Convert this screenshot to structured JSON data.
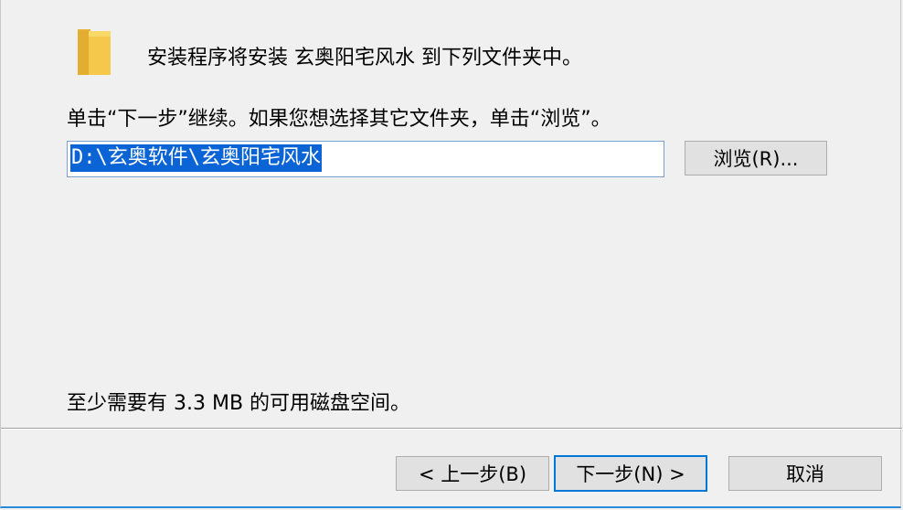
{
  "header": {
    "intro_text": "安装程序将安装 玄奥阳宅风水 到下列文件夹中。"
  },
  "body": {
    "instruction_text": "单击“下一步”继续。如果您想选择其它文件夹，单击“浏览”。",
    "install_path": "D:\\玄奥软件\\玄奥阳宅风水",
    "browse_label": "浏览(R)...",
    "space_required_text": "至少需要有 3.3 MB 的可用磁盘空间。"
  },
  "footer": {
    "back_label": "< 上一步(B)",
    "next_label": "下一步(N) >",
    "cancel_label": "取消"
  },
  "icons": {
    "folder": "folder-icon"
  },
  "colors": {
    "selection": "#0a64d6",
    "focus_border": "#0078d7",
    "folder_yellow": "#f5c84c"
  }
}
